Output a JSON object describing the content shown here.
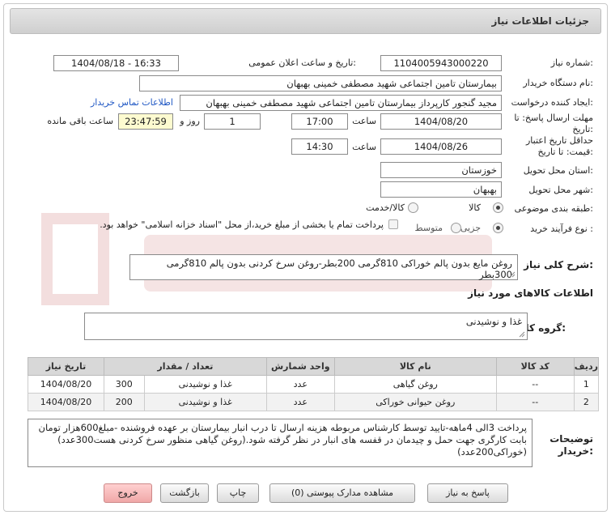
{
  "header": {
    "title": "جزئیات اطلاعات نیاز"
  },
  "fields": {
    "need_number_label": "شماره نیاز:",
    "need_number": "1104005943000220",
    "announce_label": "تاریخ و ساعت اعلان عمومی:",
    "announce_value": "1404/08/18 - 16:33",
    "buyer_org_label": "نام دستگاه خریدار:",
    "buyer_org": "بیمارستان تامین اجتماعی شهید مصطفی خمینی بهبهان",
    "creator_label": "ایجاد کننده درخواست:",
    "creator": "مجید گنجور کارپرداز بیمارستان تامین اجتماعی شهید مصطفی خمینی بهبهان",
    "contact_link": "اطلاعات تماس خریدار",
    "deadline_label_1": "مهلت ارسال پاسخ: تا",
    "deadline_label_2": "تاریخ:",
    "deadline_date": "1404/08/20",
    "time_label": "ساعت",
    "deadline_time": "17:00",
    "days": "1",
    "days_label": "روز و",
    "remaining_time": "23:47:59",
    "remaining_label": "ساعت باقی مانده",
    "validity_label_1": "حداقل تاریخ اعتبار",
    "validity_label_2": "قیمت: تا تاریخ:",
    "validity_date": "1404/08/26",
    "validity_time_label": "ساعت",
    "validity_time": "14:30",
    "province_label": "استان محل تحویل:",
    "province": "خوزستان",
    "city_label": "شهر محل تحویل:",
    "city": "بهبهان",
    "category_label": "طبقه بندی موضوعی:",
    "category_options": [
      "کالا",
      "کالا/خدمت"
    ],
    "process_label": "نوع فرآیند خرید :",
    "process_options": [
      "جزیی",
      "متوسط"
    ],
    "payment_note": "پرداخت تمام یا بخشی از مبلغ خرید،از محل \"اسناد خزانه اسلامی\" خواهد بود."
  },
  "summary": {
    "label": "شرح کلی نیاز:",
    "value": "روغن مایع بدون پالم خوراکی 810گرمی 200بطر-روغن سرخ کردنی بدون پالم 810گرمی 300بطر"
  },
  "items_section": {
    "title": "اطلاعات کالاهای مورد نیاز",
    "group_label": "گروه کالا:",
    "group_value": "غذا و نوشیدنی"
  },
  "table": {
    "headers": [
      "ردیف",
      "کد کالا",
      "نام کالا",
      "واحد شمارش",
      "تعداد / مقدار",
      "تاریخ نیاز"
    ],
    "rows": [
      [
        "1",
        "--",
        "روغن گیاهی",
        "عدد",
        "غذا و نوشیدنی",
        "300",
        "1404/08/20"
      ],
      [
        "2",
        "--",
        "روغن حیوانی خوراکی",
        "عدد",
        "غذا و نوشیدنی",
        "200",
        "1404/08/20"
      ]
    ]
  },
  "notes": {
    "label_1": "توضیحات",
    "label_2": "خریدار:",
    "value": "پرداخت 3الی 4ماهه-تایید توسط کارشناس مربوطه هزینه ارسال تا درب انبار بیمارستان بر عهده فروشنده -مبلغ600هزار تومان بابت کارگری جهت حمل و چیدمان در قفسه های انبار  در نظر گرفته شود.(روغن گیاهی منظور سرخ کردنی هست300عدد)(خوراکی200عدد)"
  },
  "buttons": {
    "reply": "پاسخ به نیاز",
    "attachments": "مشاهده مدارک پیوستی (0)",
    "print": "چاپ",
    "back": "بازگشت",
    "exit": "خروج"
  },
  "colors": {
    "link": "#1f57c4",
    "timer_bg": "#fdfbd0",
    "exit_bg": "#f0a8a8"
  }
}
